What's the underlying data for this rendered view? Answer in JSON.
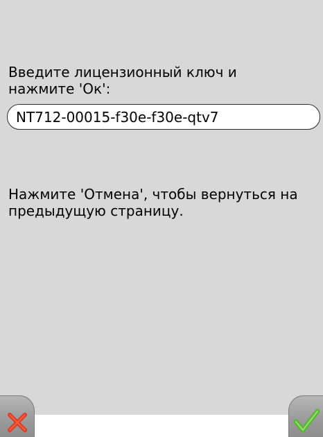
{
  "license_page": {
    "prompt": "Введите лицензионный ключ и\nнажмите 'Ок':",
    "key_value": "NT712-00015-f30e-f30e-qtv7",
    "cancel_hint": "Нажмите 'Отмена', чтобы вернуться на предыдущую страницу."
  },
  "buttons": {
    "cancel_icon": "red-x-icon",
    "ok_icon": "green-checkmark-icon",
    "cancel_color": "#e03a1e",
    "ok_color": "#57b833"
  }
}
